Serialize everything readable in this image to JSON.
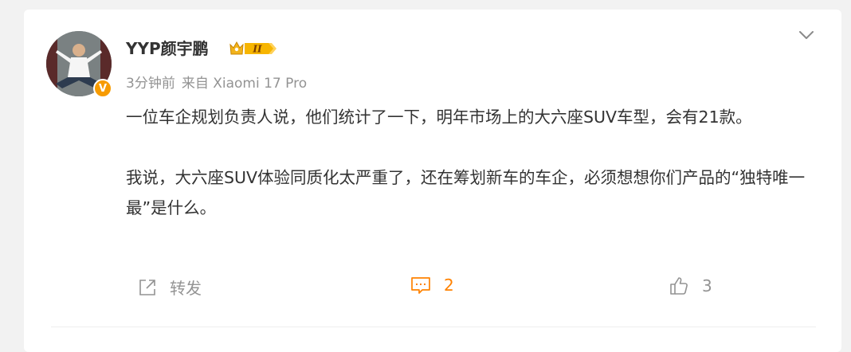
{
  "post": {
    "username": "YYP颜宇鹏",
    "verified_badge": "V",
    "level_badge": "II",
    "time": "3分钟前",
    "source": "来自 Xiaomi 17 Pro",
    "paragraphs": [
      "一位车企规划负责人说，他们统计了一下，明年市场上的大六座SUV车型，会有21款。",
      "我说，大六座SUV体验同质化太严重了，还在筹划新车的车企，必须想想你们产品的“独特唯一最”是什么。"
    ]
  },
  "actions": {
    "forward_label": "转发",
    "comment_count": "2",
    "like_count": "3"
  },
  "icons": {
    "menu": "chevron-down-icon",
    "forward": "share-icon",
    "comment": "comment-icon",
    "like": "thumbs-up-icon"
  },
  "colors": {
    "accent": "#ff8200",
    "muted": "#939393",
    "text": "#333333",
    "badge": "#f79b00"
  }
}
